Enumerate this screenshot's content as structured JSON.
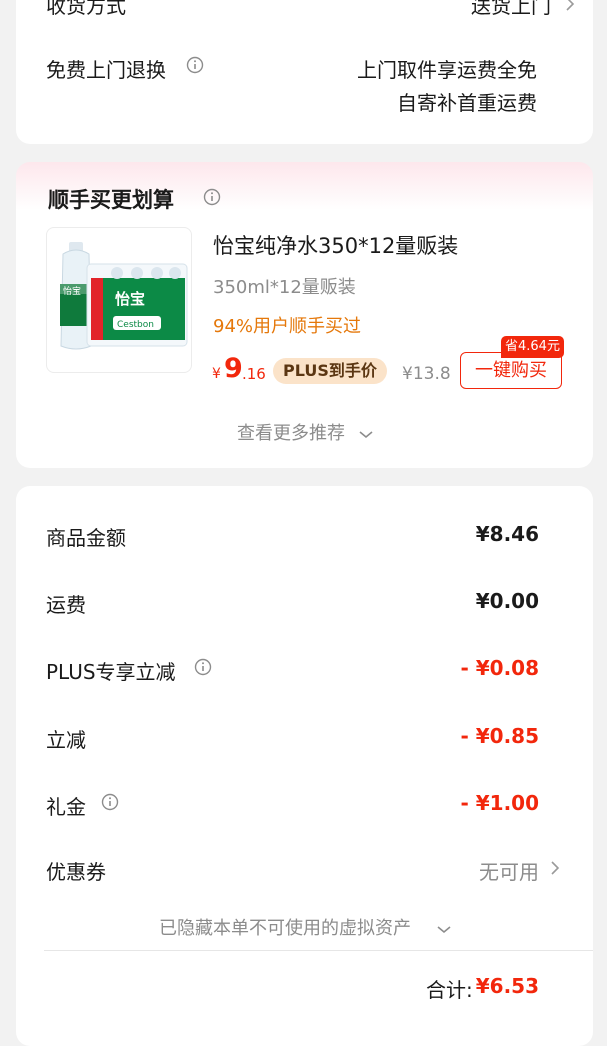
{
  "delivery": {
    "method_label": "收货方式",
    "method_value": "送货上门",
    "free_return_label": "免费上门退换",
    "free_return_value_line1": "上门取件享运费全免",
    "free_return_value_line2": "自寄补首重运费"
  },
  "recommend": {
    "title": "顺手买更划算",
    "product": {
      "name": "怡宝纯净水350*12量贩装",
      "spec": "350ml*12量贩装",
      "social_proof": "94%用户顺手买过",
      "price_symbol": "¥",
      "price_int": "9",
      "price_dec": ".16",
      "plus_tag": "PLUS到手价",
      "original_price": "¥13.8",
      "save_badge": "省4.64元",
      "buy_button": "一键购买",
      "image_brand": "怡宝",
      "image_brand_en": "Cestbon"
    },
    "more_link": "查看更多推荐"
  },
  "summary": {
    "rows": [
      {
        "label": "商品金额",
        "value": "¥8.46",
        "info": false,
        "style": "bold"
      },
      {
        "label": "运费",
        "value": "¥0.00",
        "info": false,
        "style": "bold"
      },
      {
        "label": "PLUS专享立减",
        "value": "- ¥0.08",
        "info": true,
        "style": "red"
      },
      {
        "label": "立减",
        "value": "- ¥0.85",
        "info": false,
        "style": "red"
      },
      {
        "label": "礼金",
        "value": "- ¥1.00",
        "info": true,
        "style": "red"
      },
      {
        "label": "优惠券",
        "value": "无可用",
        "info": false,
        "style": "gray"
      }
    ],
    "hidden_assets": "已隐藏本单不可使用的虚拟资产",
    "total_label": "合计:",
    "total_value": "¥6.53"
  },
  "colors": {
    "accent_red": "#f2270c",
    "orange": "#e5780b",
    "plus_bg": "#fbe3c9",
    "page_bg": "#f2f2f2"
  }
}
